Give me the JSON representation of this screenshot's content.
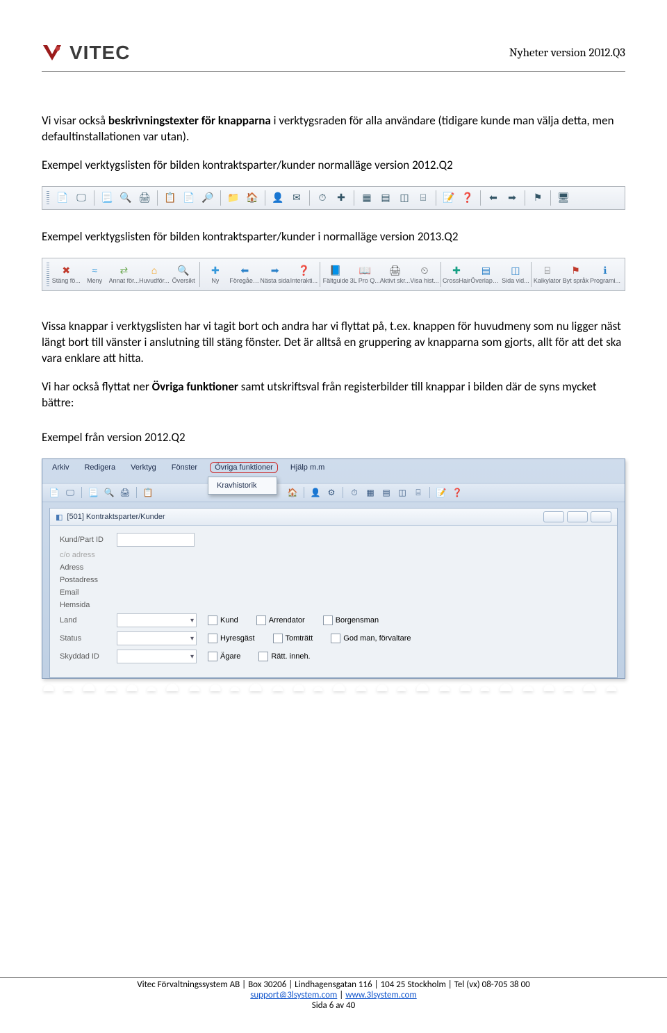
{
  "header": {
    "logo_text": "VITEC",
    "right": "Nyheter version 2012.Q3"
  },
  "paragraphs": {
    "p1a": "Vi visar också ",
    "p1b": "beskrivningstexter för knapparna",
    "p1c": " i verktygsraden för alla användare (tidigare kunde man välja detta, men defaultinstallationen var utan).",
    "p2": "Exempel verktygslisten för bilden kontraktsparter/kunder normalläge version 2012.Q2",
    "p3": "Exempel verktygslisten för bilden kontraktsparter/kunder i normalläge version 2013.Q2",
    "p4": "Vissa knappar i verktygslisten har vi tagit bort och andra har vi flyttat på, t.ex. knappen för huvudmeny som nu ligger näst längt bort till vänster i anslutning till stäng fönster. Det är alltså en gruppering av knapparna som gjorts, allt för att det ska vara enklare att hitta.",
    "p5a": "Vi har också flyttat ner ",
    "p5b": "Övriga funktioner",
    "p5c": " samt utskriftsval från registerbilder till knappar i bilden där de syns mycket bättre:",
    "p6": "Exempel från version 2012.Q2"
  },
  "toolbar2_items": [
    {
      "label": "Stäng fö...",
      "glyph": "✖",
      "color": "#c0392b"
    },
    {
      "label": "Meny",
      "glyph": "≈",
      "color": "#3498db"
    },
    {
      "label": "Annat för...",
      "glyph": "⇄",
      "color": "#6aa84f"
    },
    {
      "label": "Huvudför...",
      "glyph": "⌂",
      "color": "#f39c12"
    },
    {
      "label": "Översikt",
      "glyph": "🔍",
      "color": "#2c3e50"
    },
    {
      "label": "Ny",
      "glyph": "✚",
      "color": "#3498db"
    },
    {
      "label": "Föregåen...",
      "glyph": "⬅",
      "color": "#2c82c9"
    },
    {
      "label": "Nästa sida",
      "glyph": "➡",
      "color": "#2c82c9"
    },
    {
      "label": "Interakti...",
      "glyph": "❓",
      "color": "#2c82c9"
    },
    {
      "label": "Fältguide",
      "glyph": "📘",
      "color": "#8e6b3a"
    },
    {
      "label": "3L Pro Q...",
      "glyph": "📖",
      "color": "#8e6b3a"
    },
    {
      "label": "Aktivt skr...",
      "glyph": "🖨",
      "color": "#555"
    },
    {
      "label": "Visa hist...",
      "glyph": "⏲",
      "color": "#555"
    },
    {
      "label": "CrossHair",
      "glyph": "✚",
      "color": "#16a085"
    },
    {
      "label": "Överlapp...",
      "glyph": "▤",
      "color": "#2c82c9"
    },
    {
      "label": "Sida vid...",
      "glyph": "◫",
      "color": "#2c82c9"
    },
    {
      "label": "Kalkylator",
      "glyph": "⌸",
      "color": "#555"
    },
    {
      "label": "Byt språk",
      "glyph": "⚑",
      "color": "#c0392b"
    },
    {
      "label": "Programi...",
      "glyph": "ℹ",
      "color": "#2c82c9"
    }
  ],
  "toolbar2_sep_before": [
    5,
    9,
    13,
    16
  ],
  "app": {
    "menu": [
      "Arkiv",
      "Redigera",
      "Verktyg",
      "Fönster",
      "Övriga funktioner",
      "Hjälp m.m"
    ],
    "highlight_index": 4,
    "dropdown_label": "Kravhistorik",
    "inner_title": "[501] Kontraktsparter/Kunder",
    "fields": {
      "kund_part_id": "Kund/Part ID",
      "co_adress": "c/o adress",
      "adress": "Adress",
      "postadress": "Postadress",
      "email": "Email",
      "hemsida": "Hemsida",
      "land": "Land",
      "status": "Status",
      "skyddad_id": "Skyddad ID"
    },
    "checks_row1": [
      "Kund",
      "Arrendator",
      "Borgensman"
    ],
    "checks_row2": [
      "Hyresgäst",
      "Tomträtt",
      "God man, förvaltare"
    ],
    "checks_row3": [
      "Ägare",
      "Rätt. inneh."
    ]
  },
  "footer": {
    "line1_a": "Vitec Förvaltningssystem AB | Box 30206 | Lindhagensgatan 116 | 104 25 Stockholm | Tel (vx) 08-705 38 00",
    "email": "support@3lsystem.com",
    "sep": " | ",
    "url": "www.3lsystem.com",
    "page": "Sida 6 av 40"
  }
}
